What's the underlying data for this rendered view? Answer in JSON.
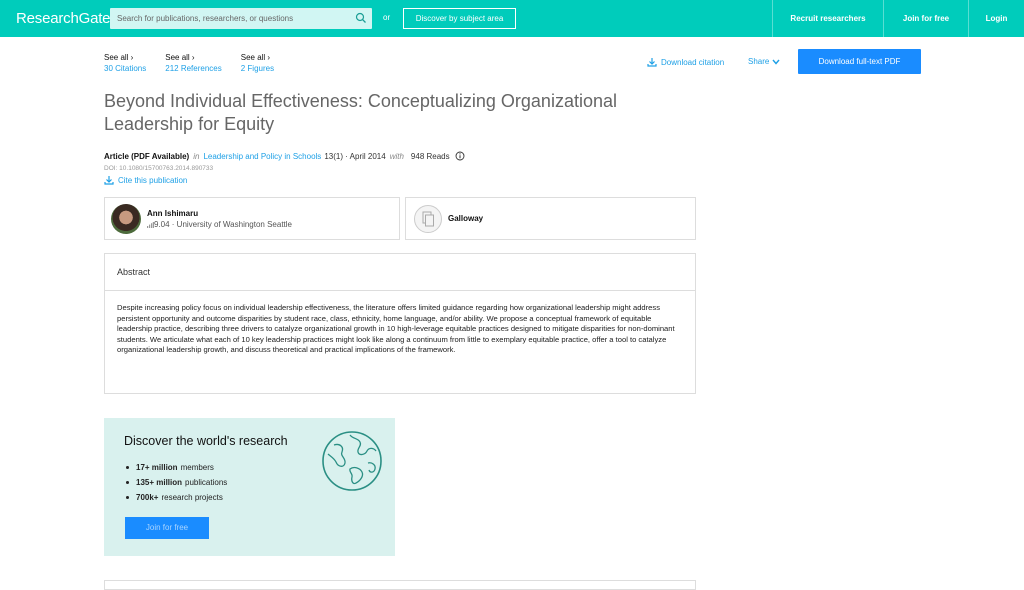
{
  "header": {
    "logo": "ResearchGate",
    "search_placeholder": "Search for publications, researchers, or questions",
    "or_label": "or",
    "discover_label": "Discover by subject area",
    "recruit_label": "Recruit researchers",
    "join_label": "Join for free",
    "login_label": "Login"
  },
  "stats": [
    {
      "see": "See all ›",
      "count": "30 Citations"
    },
    {
      "see": "See all ›",
      "count": "212 References"
    },
    {
      "see": "See all ›",
      "count": "2 Figures"
    }
  ],
  "actions": {
    "download_citation": "Download citation",
    "share": "Share",
    "download_pdf": "Download full-text PDF"
  },
  "publication": {
    "title": "Beyond Individual Effectiveness: Conceptualizing Organizational Leadership for Equity",
    "type": "Article (PDF Available)",
    "in_label": "in",
    "journal": "Leadership and Policy in Schools",
    "details": "13(1) · April 2014",
    "with_label": "with",
    "reads": "948 Reads",
    "doi": "DOI: 10.1080/15700763.2014.890733",
    "cite_label": "Cite this publication"
  },
  "authors": [
    {
      "name": "Ann Ishimaru",
      "affiliation": "9.04 · University of Washington Seattle"
    },
    {
      "name": "Galloway",
      "affiliation": ""
    }
  ],
  "abstract": {
    "heading": "Abstract",
    "text": "Despite increasing policy focus on individual leadership effectiveness, the literature offers limited guidance regarding how organizational leadership might address persistent opportunity and outcome disparities by student race, class, ethnicity, home language, and/or ability. We propose a conceptual framework of equitable leadership practice, describing three drivers to catalyze organizational growth in 10 high-leverage equitable practices designed to mitigate disparities for non-dominant students. We articulate what each of 10 key leadership practices might look like along a continuum from little to exemplary equitable practice, offer a tool to catalyze organizational leadership growth, and discuss theoretical and practical implications of the framework."
  },
  "promo": {
    "title": "Discover the world's research",
    "items": [
      {
        "bold": "17+ million",
        "rest": "members"
      },
      {
        "bold": "135+ million",
        "rest": "publications"
      },
      {
        "bold": "700k+",
        "rest": "research projects"
      }
    ],
    "join_label": "Join for free"
  },
  "colors": {
    "brand": "#00ccbb",
    "link": "#1ea0e6",
    "primary_button": "#1a8cff",
    "promo_bg": "#d9f1ee"
  }
}
